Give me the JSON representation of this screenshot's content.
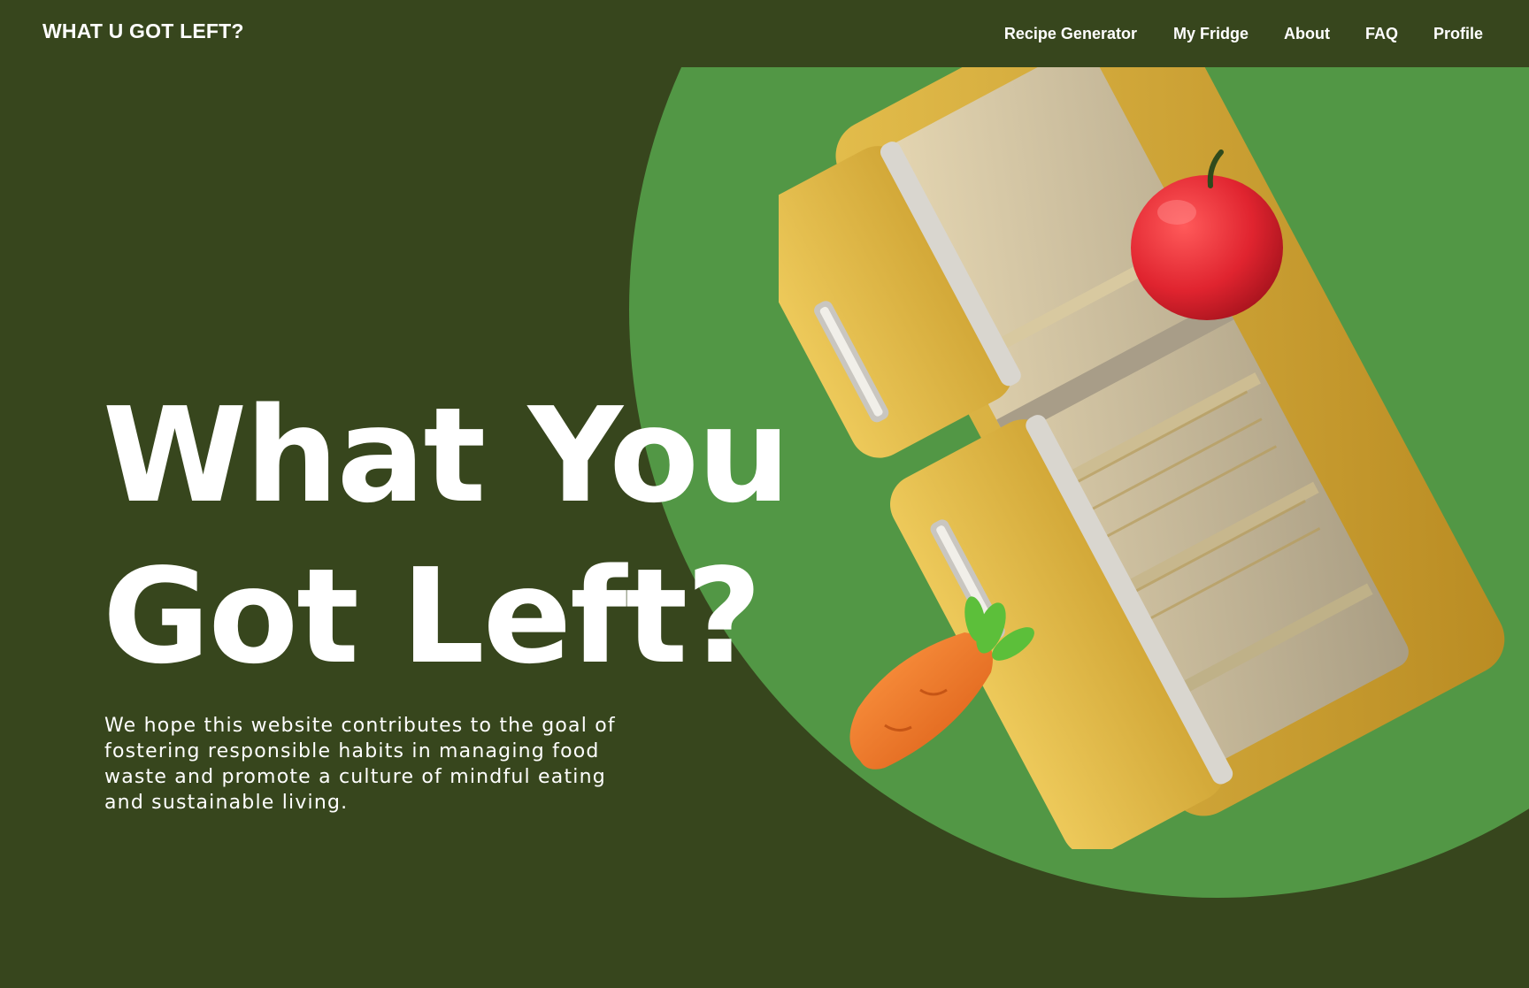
{
  "header": {
    "brand": "WHAT U GOT LEFT?",
    "nav": [
      {
        "label": "Recipe Generator"
      },
      {
        "label": "My Fridge"
      },
      {
        "label": "About"
      },
      {
        "label": "FAQ"
      },
      {
        "label": "Profile"
      }
    ]
  },
  "hero": {
    "title_line1": "What You",
    "title_line2": "Got Left?",
    "description": "We hope this website contributes to the goal of fostering responsible habits in managing food waste and promote a culture of mindful eating and sustainable living.",
    "illustration_icons": [
      "fridge-icon",
      "apple-icon",
      "carrot-icon"
    ]
  },
  "colors": {
    "background": "#37461d",
    "circle": "#529745",
    "fridge": "#d2a935",
    "apple": "#e0242f",
    "carrot": "#f07a2a",
    "text": "#ffffff"
  }
}
